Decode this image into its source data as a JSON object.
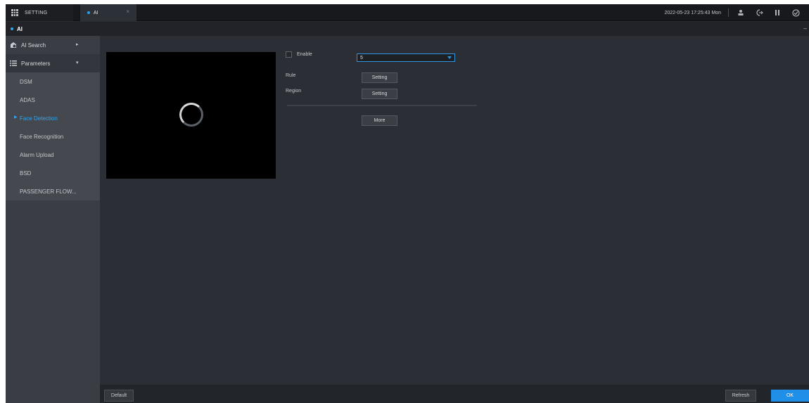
{
  "topbar": {
    "setting_label": "SETTING",
    "active_tab_label": "AI",
    "close_symbol": "×",
    "datetime": "2022-05-23 17:25:43 Mon",
    "icons": [
      "user-icon",
      "logout-icon",
      "apps-icon",
      "network-icon"
    ]
  },
  "titlebar": {
    "title": "AI",
    "minimize_symbol": "–"
  },
  "sidebar": {
    "groups": [
      {
        "label": "AI Search",
        "icon": "ai-search-icon",
        "expanded": false
      },
      {
        "label": "Parameters",
        "icon": "list-icon",
        "expanded": true
      }
    ],
    "items": [
      {
        "label": "DSM",
        "active": false
      },
      {
        "label": "ADAS",
        "active": false
      },
      {
        "label": "Face Detection",
        "active": true
      },
      {
        "label": "Face Recognition",
        "active": false
      },
      {
        "label": "Alarm Upload",
        "active": false
      },
      {
        "label": "BSD",
        "active": false
      },
      {
        "label": "PASSENGER FLOW...",
        "active": false
      }
    ]
  },
  "form": {
    "enable_label": "Enable",
    "enable_checked": false,
    "channel_value": "5",
    "rule_label": "Rule",
    "rule_button": "Setting",
    "region_label": "Region",
    "region_button": "Setting",
    "more_button": "More"
  },
  "bottombar": {
    "default_label": "Default",
    "refresh_label": "Refresh",
    "ok_label": "OK"
  },
  "colors": {
    "accent": "#1f8fe8",
    "background": "#2b2e34",
    "sidebar": "#3a3d44"
  }
}
